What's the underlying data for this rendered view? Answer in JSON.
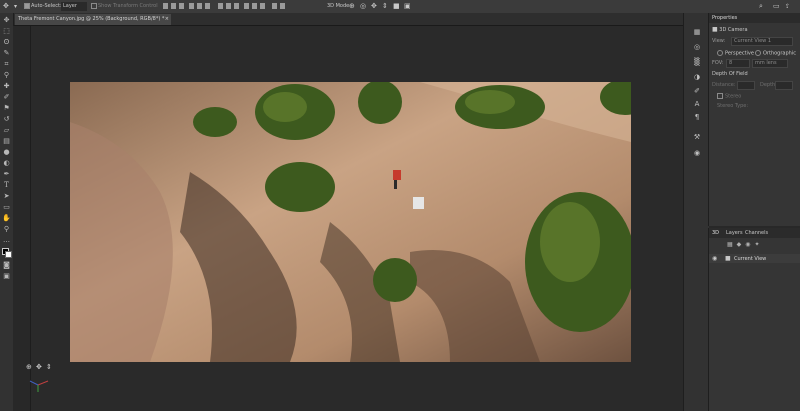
{
  "app": {
    "accent_color": "#e8c53a",
    "panel_color": "#353535",
    "canvas_color": "#282828"
  },
  "options_bar": {
    "auto_select_label": "Auto-Select:",
    "auto_select_value": "Layer",
    "show_transform_label": "Show Transform Control",
    "mode_label": "3D Mode:"
  },
  "document_tab": {
    "title": "Theta Fremont Canyon.jpg @ 25% (Background, RGB/8*) *"
  },
  "tools": [
    "move-tool",
    "marquee-tool",
    "lasso-tool",
    "quick-select-tool",
    "crop-tool",
    "eyedropper-tool",
    "healing-tool",
    "brush-tool",
    "clone-stamp-tool",
    "history-brush-tool",
    "eraser-tool",
    "gradient-tool",
    "blur-tool",
    "dodge-tool",
    "pen-tool",
    "type-tool",
    "path-select-tool",
    "rectangle-tool",
    "hand-tool",
    "zoom-tool",
    "more-tools",
    "color-swatches",
    "quick-mask",
    "screen-mode"
  ],
  "properties": {
    "title": "Properties",
    "camera_label": "3D Camera",
    "view_label": "View:",
    "view_value": "Current View 1",
    "perspective_label": "Perspective",
    "orthographic_label": "Orthographic",
    "fov_label": "FOV:",
    "fov_value": "8",
    "lens_value": "mm lens",
    "dof_label": "Depth Of Field",
    "distance_label": "Distance:",
    "depth_label": "Depth:",
    "stereo_label": "Stereo",
    "stereo_type_label": "Stereo Type:"
  },
  "layers_panel": {
    "tabs": [
      "3D",
      "Layers",
      "Channels"
    ],
    "current_view_label": "Current View"
  }
}
